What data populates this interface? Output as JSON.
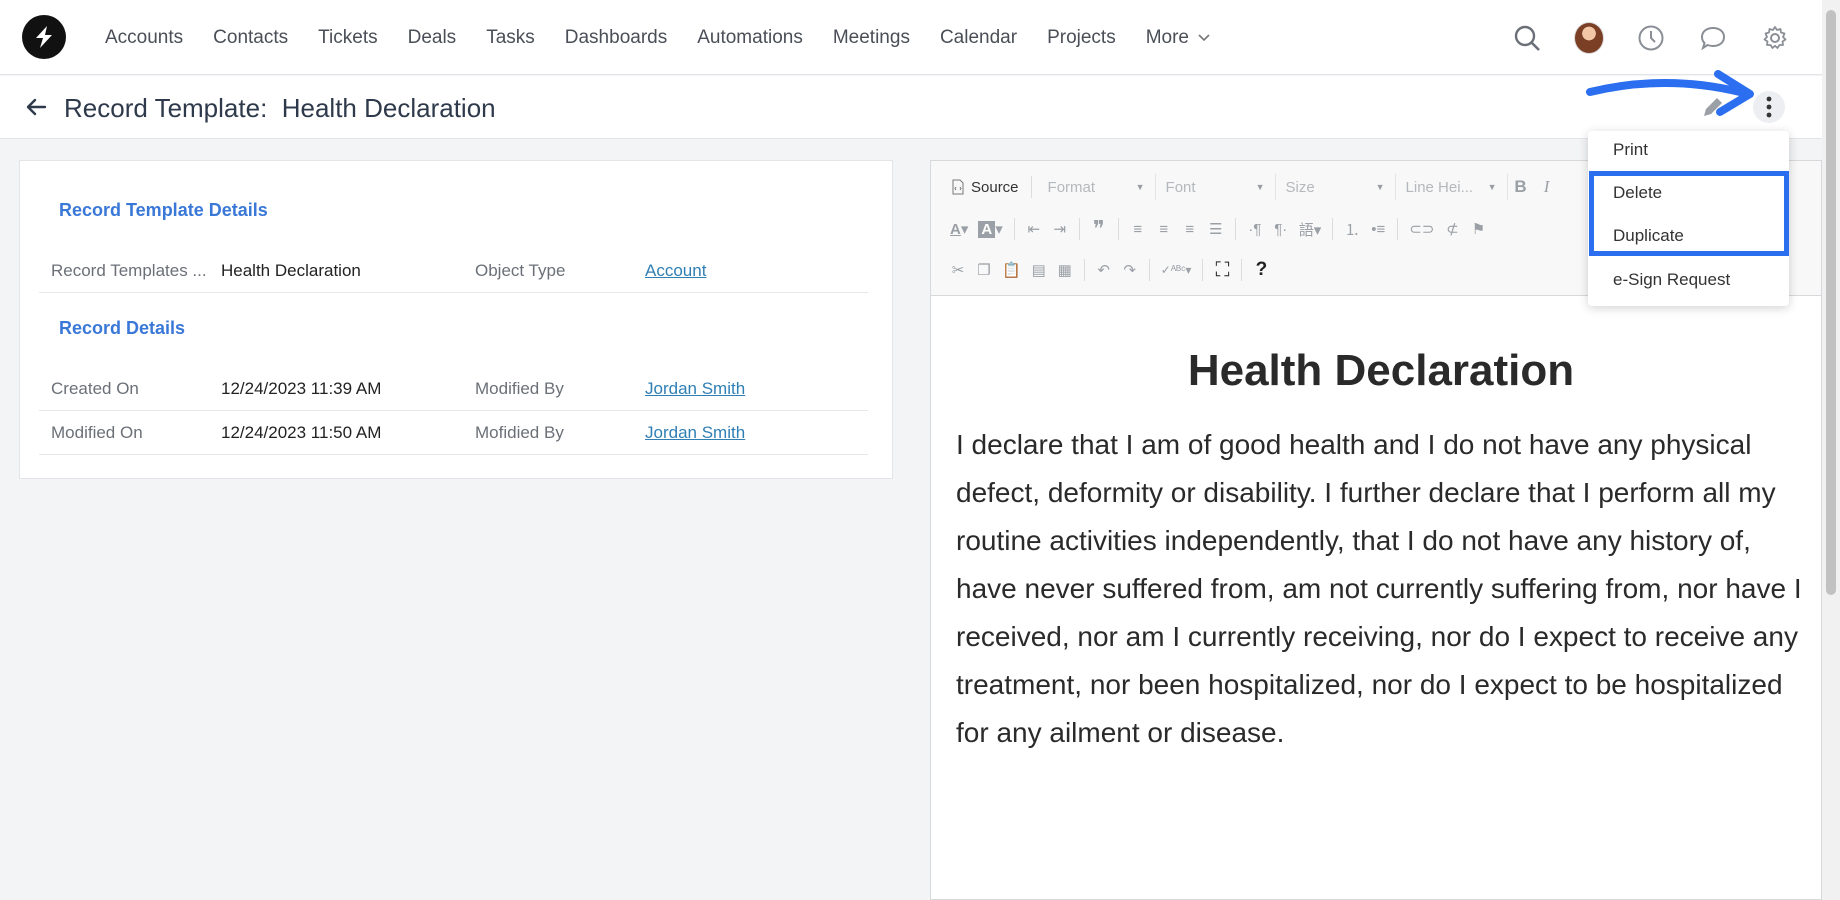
{
  "nav": {
    "items": [
      "Accounts",
      "Contacts",
      "Tickets",
      "Deals",
      "Tasks",
      "Dashboards",
      "Automations",
      "Meetings",
      "Calendar",
      "Projects"
    ],
    "more_label": "More",
    "icons": [
      "search-icon",
      "avatar",
      "clock-icon",
      "chat-icon",
      "gear-icon"
    ]
  },
  "header": {
    "title": "Record Template:  Health Declaration"
  },
  "details": {
    "section1_title": "Record Template Details",
    "section2_title": "Record Details",
    "fields": {
      "template_name_label": "Record Templates ...",
      "template_name_value": "Health Declaration",
      "object_type_label": "Object Type",
      "object_type_value": "Account",
      "created_on_label": "Created On",
      "created_on_value": "12/24/2023 11:39 AM",
      "modified_by_label": "Modified By",
      "modified_by_value": "Jordan Smith",
      "modified_on_label": "Modified On",
      "modified_on_value": "12/24/2023 11:50 AM",
      "mofidied_by_label": "Mofidied By",
      "mofidied_by_value": "Jordan Smith"
    }
  },
  "editor": {
    "source_label": "Source",
    "format_placeholder": "Format",
    "font_placeholder": "Font",
    "size_placeholder": "Size",
    "line_height_placeholder": "Line Hei...",
    "doc_title": "Health Declaration",
    "doc_body": "I declare that I am of good health and I do not have any physical defect, deformity or disability. I further declare that I perform all my routine activities independently, that I do not have any history of, have never suffered from, am not currently suffering from, nor have I received, nor am I currently receiving, nor do I expect to receive any treatment, nor been hospitalized, nor do I expect to be hospitalized for any ailment or disease."
  },
  "menu": {
    "items": [
      "Print",
      "Delete",
      "Duplicate",
      "e-Sign Request"
    ]
  },
  "colors": {
    "accent": "#3a78d8",
    "highlight": "#2b6ef0",
    "link": "#2f7fb5"
  }
}
